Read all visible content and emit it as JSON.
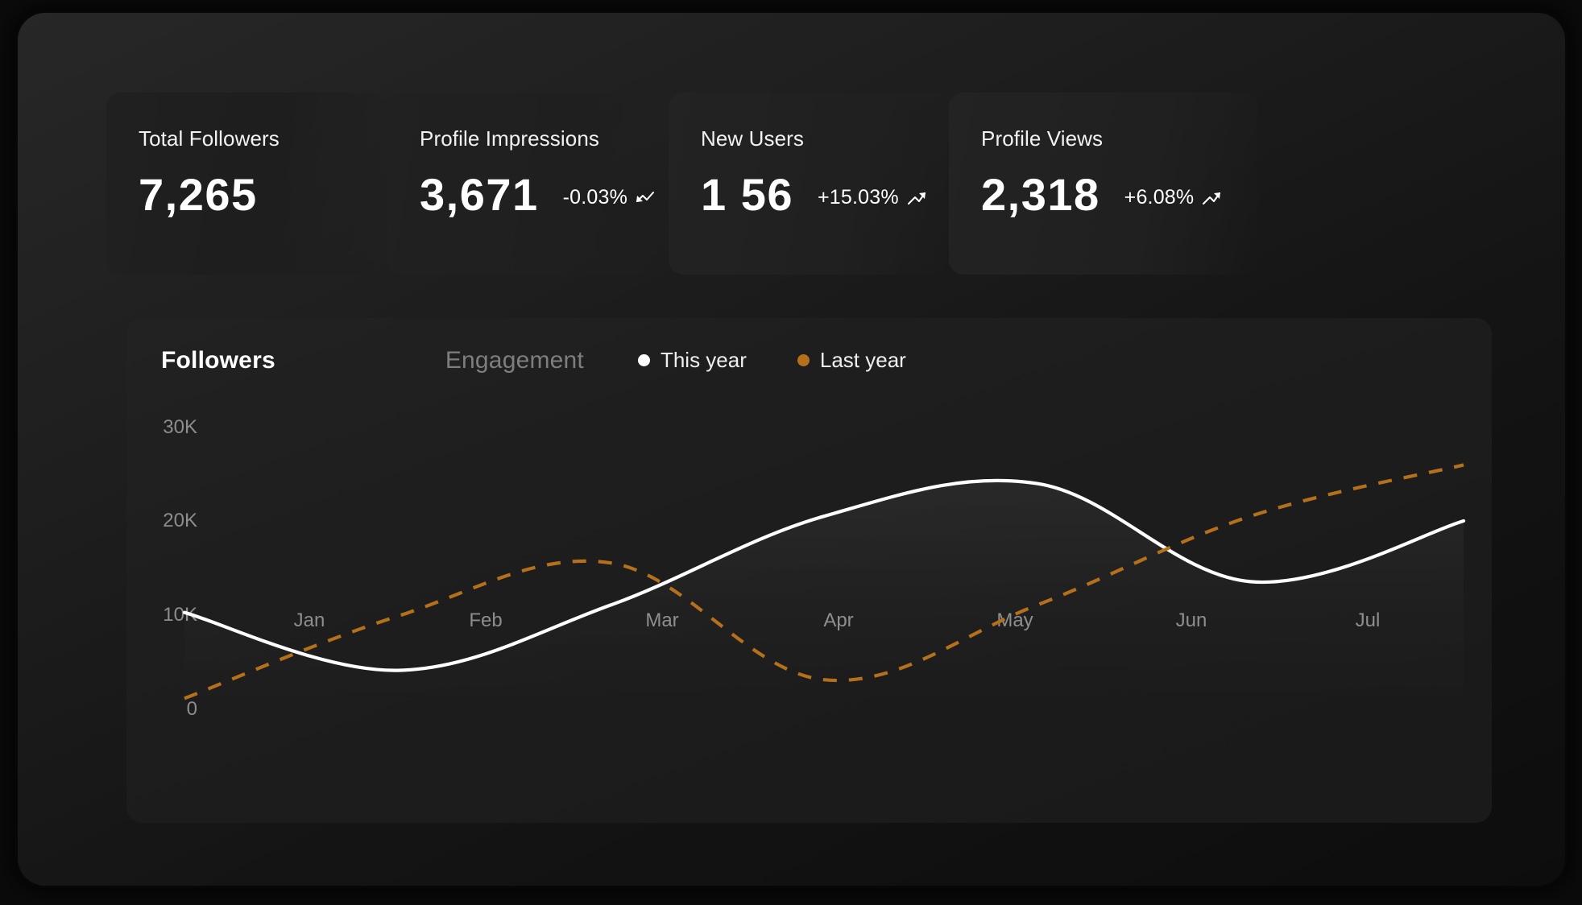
{
  "stats": [
    {
      "label": "Total Followers",
      "value": "7,265",
      "delta": "",
      "trend": "none"
    },
    {
      "label": "Profile Impressions",
      "value": "3,671",
      "delta": "-0.03%",
      "trend": "trend-down-icon"
    },
    {
      "label": "New Users",
      "value": "1 56",
      "delta": "+15.03%",
      "trend": "trend-up-icon"
    },
    {
      "label": "Profile Views",
      "value": "2,318",
      "delta": "+6.08%",
      "trend": "trend-up-icon"
    }
  ],
  "chart": {
    "tabs": [
      {
        "label": "Followers",
        "active": true
      },
      {
        "label": "Engagement",
        "active": false
      }
    ],
    "legend": [
      {
        "label": "This year",
        "color": "#ffffff"
      },
      {
        "label": "Last year",
        "color": "#b5701c"
      }
    ]
  },
  "colors": {
    "this_year_line": "#ffffff",
    "last_year_line": "#b5701c",
    "card_background": "#1f1f1f",
    "panel_background": "#1e1e1e",
    "axis_text": "#8d8d8d",
    "inactive_tab": "#7e7e7e"
  },
  "chart_data": {
    "type": "line",
    "title": "Followers",
    "xlabel": "",
    "ylabel": "",
    "grid": false,
    "legend_position": "top",
    "x": [
      "Jan",
      "Feb",
      "Mar",
      "Apr",
      "May",
      "Jun",
      "Jul"
    ],
    "xtick_labels": [
      "Jan",
      "Feb",
      "Mar",
      "Apr",
      "May",
      "Jun",
      "Jul"
    ],
    "ytick_labels": [
      "0",
      "10K",
      "20K",
      "30K"
    ],
    "ytick_values": [
      0,
      10000,
      20000,
      30000
    ],
    "ylim": [
      0,
      30000
    ],
    "series": [
      {
        "name": "This year",
        "color": "#ffffff",
        "style": "solid",
        "values": [
          10200,
          4000,
          11000,
          20500,
          24000,
          13500,
          20000
        ]
      },
      {
        "name": "Last year",
        "color": "#b5701c",
        "style": "dashed",
        "values": [
          1000,
          9800,
          15500,
          3000,
          11000,
          20500,
          26000
        ]
      }
    ]
  }
}
